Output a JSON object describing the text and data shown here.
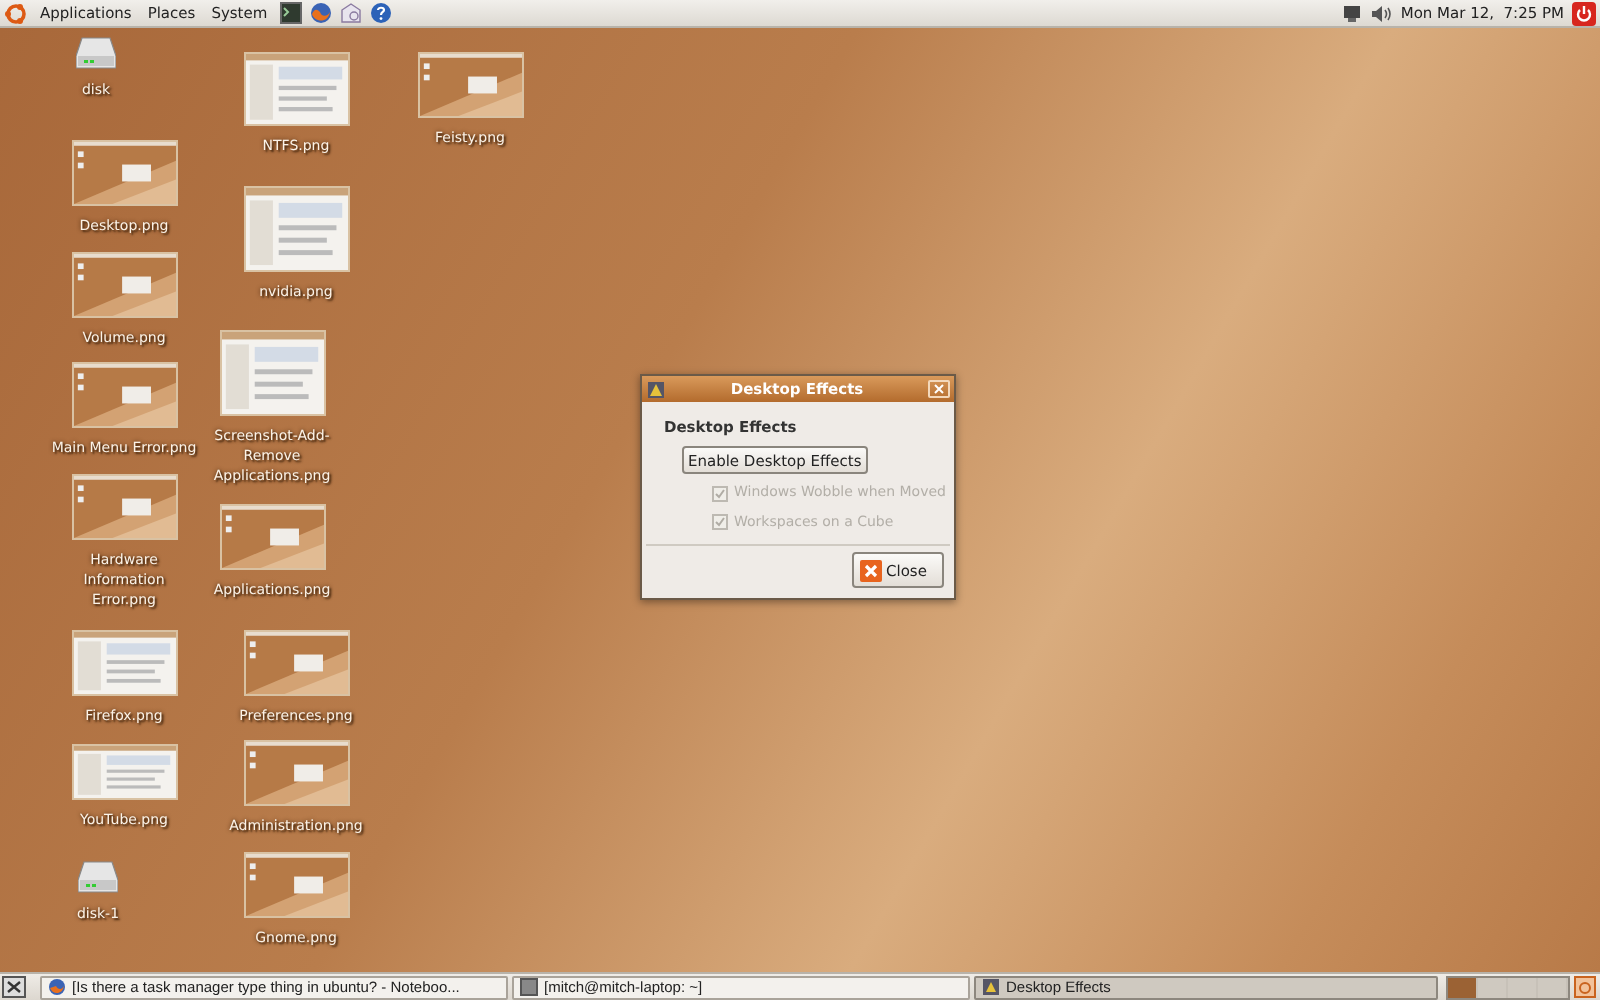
{
  "top_panel": {
    "menus": [
      "Applications",
      "Places",
      "System"
    ],
    "clock": "Mon Mar 12,  7:25 PM"
  },
  "desktop_icons": [
    {
      "kind": "drive",
      "label": "disk"
    },
    {
      "kind": "thumbnail",
      "label": "Desktop.png"
    },
    {
      "kind": "thumbnail",
      "label": "Volume.png"
    },
    {
      "kind": "thumbnail",
      "label": "Main Menu Error.png"
    },
    {
      "kind": "thumbnail",
      "label": "Hardware Information Error.png"
    },
    {
      "kind": "thumbnail",
      "label": "Firefox.png"
    },
    {
      "kind": "thumbnail",
      "label": "YouTube.png"
    },
    {
      "kind": "drive",
      "label": "disk-1"
    },
    {
      "kind": "thumbnail",
      "label": "NTFS.png"
    },
    {
      "kind": "thumbnail",
      "label": "nvidia.png"
    },
    {
      "kind": "thumbnail",
      "label": "Screenshot-Add-Remove Applications.png"
    },
    {
      "kind": "thumbnail",
      "label": "Applications.png"
    },
    {
      "kind": "thumbnail",
      "label": "Preferences.png"
    },
    {
      "kind": "thumbnail",
      "label": "Administration.png"
    },
    {
      "kind": "thumbnail",
      "label": "Gnome.png"
    },
    {
      "kind": "thumbnail",
      "label": "Feisty.png"
    }
  ],
  "dialog": {
    "title": "Desktop Effects",
    "heading": "Desktop Effects",
    "enable_button": "Enable Desktop Effects",
    "options": [
      {
        "label": "Windows Wobble when Moved",
        "checked": true,
        "disabled": true
      },
      {
        "label": "Workspaces on a Cube",
        "checked": true,
        "disabled": true
      }
    ],
    "close_button": "Close"
  },
  "taskbar": {
    "tasks": [
      {
        "kind": "browser",
        "label": "[Is there a task manager type thing in ubuntu? - Noteboo...",
        "selected": false
      },
      {
        "kind": "terminal",
        "label": "[mitch@mitch-laptop: ~]",
        "selected": false
      },
      {
        "kind": "dialog",
        "label": "Desktop Effects",
        "selected": true
      }
    ],
    "workspaces": [
      {
        "selected": true
      },
      {
        "selected": false
      },
      {
        "selected": false
      },
      {
        "selected": false
      }
    ]
  }
}
